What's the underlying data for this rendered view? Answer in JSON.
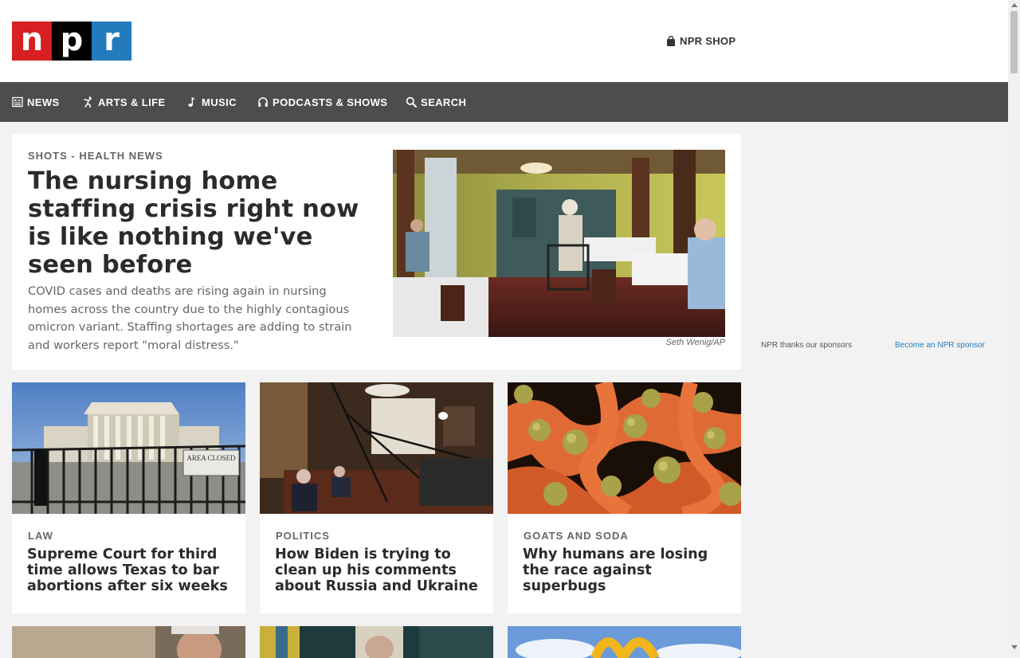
{
  "header": {
    "logo": {
      "n": "n",
      "p": "p",
      "r": "r"
    },
    "shop_label": "NPR SHOP"
  },
  "nav": {
    "items": [
      {
        "label": "NEWS",
        "icon": "news-icon"
      },
      {
        "label": "ARTS & LIFE",
        "icon": "dancer-icon"
      },
      {
        "label": "MUSIC",
        "icon": "music-note-icon"
      },
      {
        "label": "PODCASTS & SHOWS",
        "icon": "headphones-icon"
      },
      {
        "label": "SEARCH",
        "icon": "search-icon"
      }
    ]
  },
  "featured": {
    "kicker": "SHOTS - HEALTH NEWS",
    "headline": "The nursing home staffing crisis right now is like nothing we've seen before",
    "teaser": "COVID cases and deaths are rising again in nursing homes across the country due to the highly contagious omicron variant. Staffing shortages are adding to strain and workers report \"moral distress.\"",
    "credit": "Seth Wenig/AP"
  },
  "sponsor": {
    "note": "NPR thanks our sponsors",
    "link": "Become an NPR sponsor"
  },
  "cards": [
    {
      "kicker": "LAW",
      "headline": "Supreme Court for third time allows Texas to bar abortions after six weeks",
      "sign": "AREA CLOSED"
    },
    {
      "kicker": "POLITICS",
      "headline": "How Biden is trying to clean up his comments about Russia and Ukraine"
    },
    {
      "kicker": "GOATS AND SODA",
      "headline": "Why humans are losing the race against superbugs"
    }
  ],
  "colors": {
    "npr_red": "#d62021",
    "npr_black": "#000000",
    "npr_blue": "#237bbd",
    "nav_bg": "#4d4d4d",
    "page_bg": "#f2f2f2"
  }
}
